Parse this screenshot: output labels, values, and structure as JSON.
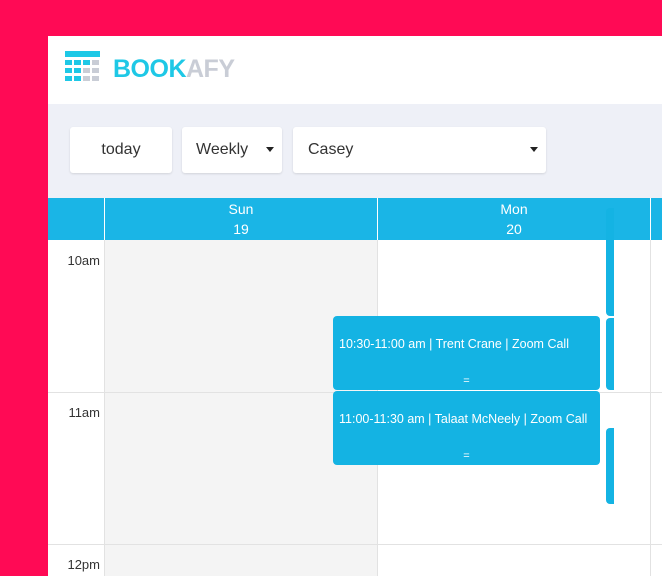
{
  "brand": {
    "name_part1": "BOOK",
    "name_part2": "AFY",
    "primary_color": "#1ec8e6",
    "secondary_color": "#c9cdd6",
    "icon": "calendar-grid-icon"
  },
  "colors": {
    "background": "#ff0a55",
    "header_bar": "#1ab5e6",
    "event": "#14b3e3"
  },
  "toolbar": {
    "today_label": "today",
    "view_select": "Weekly",
    "staff_select": "Casey"
  },
  "calendar": {
    "days": [
      {
        "name": "Sun",
        "date": "19"
      },
      {
        "name": "Mon",
        "date": "20"
      }
    ],
    "times": [
      "10am",
      "11am",
      "12pm"
    ],
    "events": [
      {
        "day": "Mon",
        "title": "10:30-11:00 am | Trent Crane | Zoom Call",
        "handle": "="
      },
      {
        "day": "Mon",
        "title": "11:00-11:30 am | Talaat McNeely | Zoom Call",
        "handle": "="
      }
    ]
  }
}
